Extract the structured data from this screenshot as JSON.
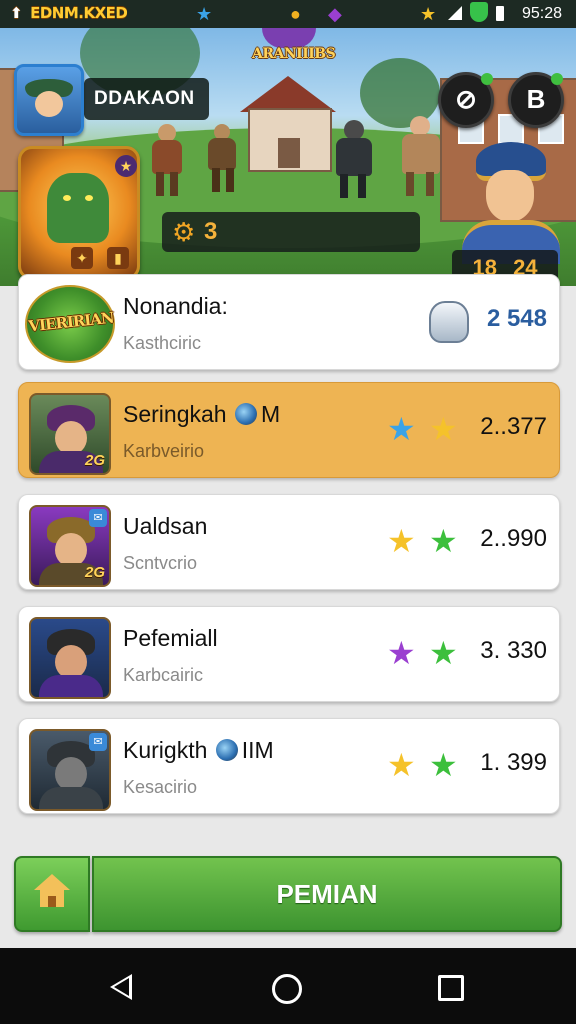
{
  "status_bar": {
    "logo": "EDNM.KXED",
    "time": "95:28"
  },
  "hero": {
    "game_title": "ARANIIIBS",
    "player_name": "DDAKAON",
    "resource_value": "3",
    "stat_left": "18",
    "stat_right": "24",
    "profile_button_label": "B"
  },
  "list": {
    "rows": [
      {
        "emblem_text": "VIERIRIAN",
        "name": "Nonandia:",
        "subtitle": "Kasthciric",
        "score": "2  548",
        "trophy": "tooth-icon"
      },
      {
        "thumb_num": "2G",
        "name": "Seringkah",
        "name_suffix": "M",
        "subtitle": "Karbveirio",
        "score": "2..377",
        "stars": [
          "#3aa3e8",
          "#f5c22a"
        ],
        "highlight": true
      },
      {
        "thumb_num": "2G",
        "name": "Ualdsan",
        "subtitle": "Scntvcrio",
        "score": "2..990",
        "stars": [
          "#f5c22a",
          "#3cbf3c"
        ]
      },
      {
        "name": "Pefemiall",
        "subtitle": "Karbcairic",
        "score": "3. 330",
        "stars": [
          "#9a3fd0",
          "#3cbf3c"
        ]
      },
      {
        "name": "Kurigkth",
        "name_suffix": "IIM",
        "subtitle": "Kesacirio",
        "score": "1. 399",
        "stars": [
          "#f5c22a",
          "#3cbf3c"
        ]
      }
    ]
  },
  "action_bar": {
    "main_label": "PEMIAN"
  },
  "colors": {
    "accent_green": "#4da83a",
    "highlight_orange": "#eeb453",
    "score_blue": "#2a5d9f"
  }
}
